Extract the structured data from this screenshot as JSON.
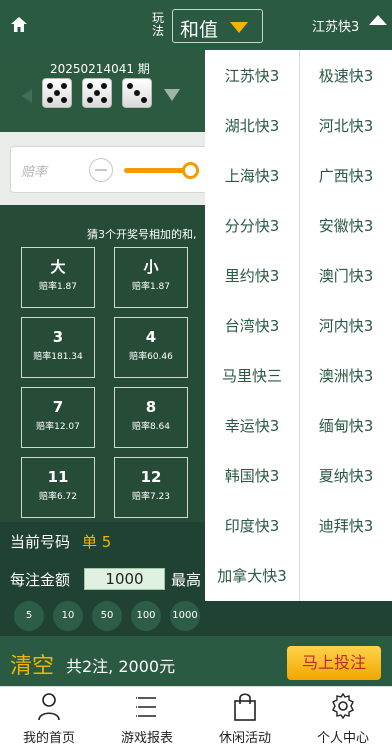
{
  "header": {
    "play_label": "玩法",
    "selected_play": "和值",
    "region": "江苏快3"
  },
  "draw": {
    "period": "20250214041 期",
    "dice": [
      5,
      5,
      3
    ]
  },
  "odds": {
    "placeholder": "赔率"
  },
  "bet": {
    "description": "猜3个开奖号相加的和,",
    "options": [
      {
        "label": "大",
        "rate": "赔率1.87"
      },
      {
        "label": "小",
        "rate": "赔率1.87"
      },
      {
        "label": "3",
        "rate": "赔率181.34"
      },
      {
        "label": "4",
        "rate": "赔率60.46"
      },
      {
        "label": "7",
        "rate": "赔率12.07"
      },
      {
        "label": "8",
        "rate": "赔率8.64"
      },
      {
        "label": "11",
        "rate": "赔率6.72"
      },
      {
        "label": "12",
        "rate": "赔率7.23"
      }
    ]
  },
  "current": {
    "label": "当前号码",
    "value": "单 5"
  },
  "amount": {
    "label": "每注金额",
    "value": "1000",
    "max_label": "最高"
  },
  "chips": [
    "5",
    "10",
    "50",
    "100",
    "1000"
  ],
  "betbar": {
    "clear": "清空",
    "summary": "共2注, 2000元",
    "submit": "马上投注"
  },
  "tabs": [
    {
      "label": "我的首页",
      "icon": "person-icon"
    },
    {
      "label": "游戏报表",
      "icon": "list-icon"
    },
    {
      "label": "休闲活动",
      "icon": "bag-icon"
    },
    {
      "label": "个人中心",
      "icon": "gear-icon"
    }
  ],
  "dropdown": {
    "left": [
      "江苏快3",
      "湖北快3",
      "上海快3",
      "分分快3",
      "里约快3",
      "台湾快3",
      "马里快三",
      "幸运快3",
      "韩国快3",
      "印度快3",
      "加拿大快3"
    ],
    "right": [
      "极速快3",
      "河北快3",
      "广西快3",
      "安徽快3",
      "澳门快3",
      "河内快3",
      "澳洲快3",
      "缅甸快3",
      "夏纳快3",
      "迪拜快3"
    ]
  }
}
